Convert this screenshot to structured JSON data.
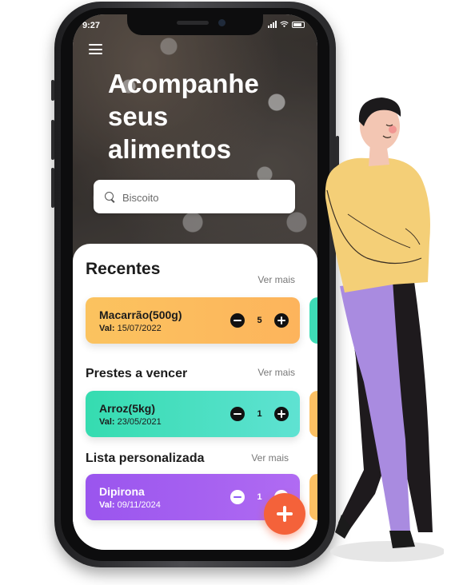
{
  "status_bar": {
    "time": "9:27"
  },
  "hero": {
    "title": "Acompanhe seus alimentos"
  },
  "search": {
    "placeholder": "Biscoito"
  },
  "sections": [
    {
      "title": "Recentes",
      "see_more": "Ver mais",
      "card": {
        "name": "Macarrão(500g)",
        "date_label": "Val:",
        "date": "15/07/2022",
        "quantity": "5",
        "color": "#fcc063"
      }
    },
    {
      "title": "Prestes a vencer",
      "see_more": "Ver mais",
      "card": {
        "name": "Arroz(5kg)",
        "date_label": "Val:",
        "date": "23/05/2021",
        "quantity": "1",
        "color": "#3edcb6"
      }
    },
    {
      "title": "Lista personalizada",
      "see_more": "Ver mais",
      "card": {
        "name": "Dipirona",
        "date_label": "Val:",
        "date": "09/11/2024",
        "quantity": "1",
        "color": "#9b5cf0"
      }
    }
  ],
  "fab": {
    "icon": "plus-icon",
    "color": "#f4623a"
  }
}
